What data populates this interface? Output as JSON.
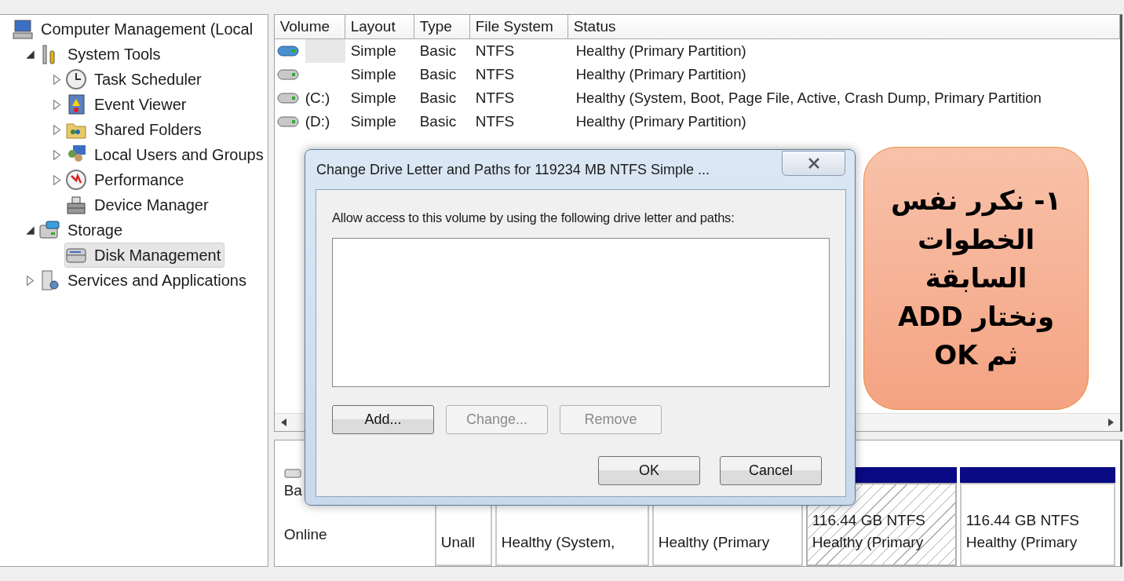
{
  "tree": [
    {
      "label": "Computer Management (Local",
      "kind": "root",
      "selected": false,
      "children": [
        {
          "label": "System Tools",
          "kind": "group",
          "expanded": true,
          "selected": false,
          "children": [
            {
              "label": "Task Scheduler",
              "kind": "group",
              "expanded": false,
              "selected": false
            },
            {
              "label": "Event Viewer",
              "kind": "group",
              "expanded": false,
              "selected": false
            },
            {
              "label": "Shared Folders",
              "kind": "group",
              "expanded": false,
              "selected": false
            },
            {
              "label": "Local Users and Groups",
              "kind": "group",
              "expanded": false,
              "selected": false
            },
            {
              "label": "Performance",
              "kind": "group",
              "expanded": false,
              "selected": false
            },
            {
              "label": "Device Manager",
              "kind": "leaf",
              "selected": false
            }
          ]
        },
        {
          "label": "Storage",
          "kind": "group",
          "expanded": true,
          "selected": false,
          "children": [
            {
              "label": "Disk Management",
              "kind": "leaf",
              "selected": true
            }
          ]
        },
        {
          "label": "Services and Applications",
          "kind": "group",
          "expanded": false,
          "selected": false
        }
      ]
    }
  ],
  "volume_table": {
    "columns": [
      "Volume",
      "Layout",
      "Type",
      "File System",
      "Status"
    ],
    "rows": [
      {
        "selected": true,
        "layout": "Simple",
        "type": "Basic",
        "file_system": "NTFS",
        "status": "Healthy (Primary Partition)"
      },
      {
        "selected": false,
        "layout": "Simple",
        "type": "Basic",
        "file_system": "NTFS",
        "status": "Healthy (Primary Partition)"
      },
      {
        "selected": false,
        "volume": "(C:)",
        "layout": "Simple",
        "type": "Basic",
        "file_system": "NTFS",
        "status": "Healthy (System, Boot, Page File, Active, Crash Dump, Primary Partition"
      },
      {
        "selected": false,
        "volume": "(D:)",
        "layout": "Simple",
        "type": "Basic",
        "file_system": "NTFS",
        "status": "Healthy (Primary Partition)"
      }
    ]
  },
  "disk_pane": {
    "disk": {
      "name": "Ba",
      "status": "Online"
    },
    "partitions": [
      {
        "selected": false,
        "status": "Unall"
      },
      {
        "selected": false,
        "status": "Healthy (System,"
      },
      {
        "selected": false,
        "status": "Healthy (Primary"
      },
      {
        "selected": true,
        "size": "116.44 GB NTFS",
        "status": "Healthy (Primary"
      },
      {
        "selected": false,
        "size": "116.44 GB NTFS",
        "status": "Healthy (Primary"
      }
    ]
  },
  "dialog": {
    "title": "Change Drive Letter and Paths for 119234 MB NTFS Simple ...",
    "prompt": "Allow access to this volume by using the following drive letter and paths:",
    "actions": [
      {
        "label": "Add...",
        "disabled": false
      },
      {
        "label": "Change...",
        "disabled": true
      },
      {
        "label": "Remove",
        "disabled": true
      }
    ],
    "buttons": [
      {
        "label": "OK",
        "disabled": false
      },
      {
        "label": "Cancel",
        "disabled": false
      }
    ]
  },
  "callout": {
    "text": "١- نكرر نفس الخطوات السابقة ونختار ADD ثم OK"
  }
}
